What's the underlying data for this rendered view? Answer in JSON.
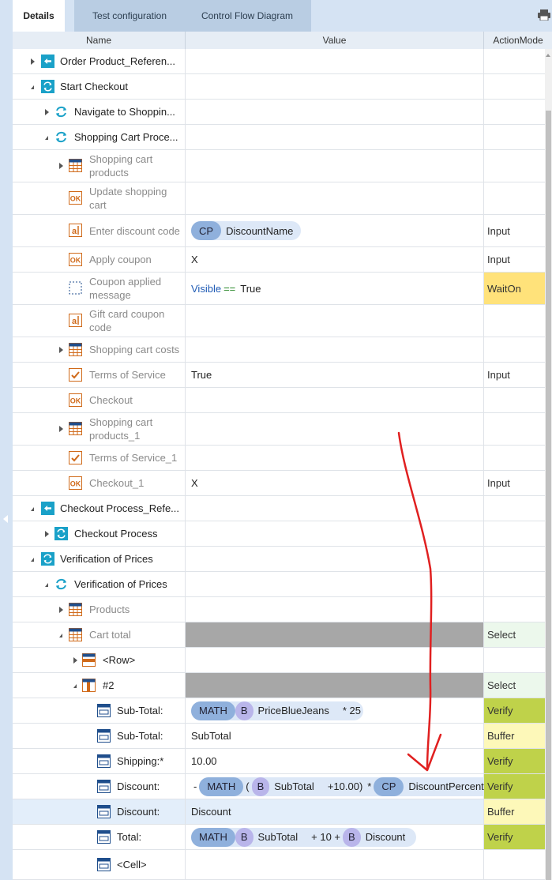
{
  "tabs": [
    {
      "label": "Details",
      "active": true
    },
    {
      "label": "Test configuration",
      "active": false
    },
    {
      "label": "Control Flow Diagram",
      "active": false
    }
  ],
  "columns": {
    "name": "Name",
    "value": "Value",
    "action": "ActionMode"
  },
  "rows": [
    {
      "label": "Order Product_Referen...",
      "icon": "reference-icon",
      "style": "dark",
      "expand": "collapsed"
    },
    {
      "label": "Start Checkout",
      "icon": "folder-module-icon",
      "style": "dark",
      "expand": "open"
    },
    {
      "label": "Navigate to Shoppin...",
      "icon": "refresh-module-icon",
      "style": "dark",
      "expand": "collapsed"
    },
    {
      "label": "Shopping Cart Proce...",
      "icon": "refresh-module-icon",
      "style": "dark",
      "expand": "open"
    },
    {
      "label": "Shopping cart products",
      "icon": "table-icon",
      "style": "dim",
      "expand": "collapsed"
    },
    {
      "label": "Update shopping cart",
      "icon": "ok-button-icon",
      "style": "dim"
    },
    {
      "label": "Enter discount code",
      "icon": "textbox-icon",
      "style": "dim",
      "action": "Input"
    },
    {
      "label": "Apply coupon",
      "icon": "ok-button-icon",
      "style": "dim",
      "value_text": "X",
      "action": "Input"
    },
    {
      "label": "Coupon applied message",
      "icon": "dashed-box-icon",
      "style": "dim",
      "action": "WaitOn"
    },
    {
      "label": "Gift card coupon code",
      "icon": "textbox-icon",
      "style": "dim"
    },
    {
      "label": "Shopping cart costs",
      "icon": "table-icon",
      "style": "dim",
      "expand": "collapsed"
    },
    {
      "label": "Terms of Service",
      "icon": "checkbox-icon",
      "style": "dim",
      "value_text": "True",
      "action": "Input"
    },
    {
      "label": "Checkout",
      "icon": "ok-button-icon",
      "style": "dim"
    },
    {
      "label": "Shopping cart products_1",
      "icon": "table-icon",
      "style": "dim",
      "expand": "collapsed"
    },
    {
      "label": "Terms of Service_1",
      "icon": "checkbox-icon",
      "style": "dim"
    },
    {
      "label": "Checkout_1",
      "icon": "ok-button-icon",
      "style": "dim",
      "value_text": "X",
      "action": "Input"
    },
    {
      "label": "Checkout Process_Refe...",
      "icon": "reference-icon",
      "style": "dark",
      "expand": "open"
    },
    {
      "label": "Checkout Process",
      "icon": "folder-module-icon",
      "style": "dark",
      "expand": "collapsed"
    },
    {
      "label": "Verification of Prices",
      "icon": "folder-module-icon",
      "style": "dark",
      "expand": "open"
    },
    {
      "label": "Verification of Prices",
      "icon": "refresh-module-icon",
      "style": "dark",
      "expand": "open"
    },
    {
      "label": "Products",
      "icon": "table-icon",
      "style": "dim",
      "expand": "collapsed"
    },
    {
      "label": "Cart total",
      "icon": "table-icon",
      "style": "dim",
      "expand": "open",
      "action": "Select"
    },
    {
      "label": "<Row>",
      "icon": "table-row-icon",
      "style": "dark",
      "expand": "collapsed"
    },
    {
      "label": "#2",
      "icon": "table-column-icon",
      "style": "dark",
      "expand": "open",
      "action": "Select"
    },
    {
      "label": "Sub-Total:",
      "icon": "cell-icon",
      "style": "dark",
      "action": "Verify"
    },
    {
      "label": "Sub-Total:",
      "icon": "cell-icon",
      "style": "dark",
      "value_text": "SubTotal",
      "action": "Buffer"
    },
    {
      "label": "Shipping:*",
      "icon": "cell-icon",
      "style": "dark",
      "value_text": "10.00",
      "action": "Verify"
    },
    {
      "label": "Discount:",
      "icon": "cell-icon",
      "style": "dark",
      "action": "Verify"
    },
    {
      "label": "Discount:",
      "icon": "cell-icon",
      "style": "dark",
      "value_text": "Discount",
      "action": "Buffer"
    },
    {
      "label": "Total:",
      "icon": "cell-icon",
      "style": "dark",
      "action": "Verify"
    },
    {
      "label": "<Cell>",
      "icon": "cell-icon",
      "style": "dark"
    }
  ],
  "expr": {
    "discount_code": {
      "tag": "CP",
      "name": "DiscountName"
    },
    "coupon_msg": {
      "prop": "Visible",
      "op": "==",
      "val": "True"
    },
    "subtotal_verify": {
      "math": "MATH",
      "tag": "B",
      "name": "PriceBlueJeans",
      "rest": "* 25"
    },
    "discount_verify": {
      "minus": "-",
      "math": "MATH",
      "open": "(",
      "tag1": "B",
      "name1": "SubTotal",
      "mid": "+10.00)",
      "times": "*",
      "tag2": "CP",
      "name2": "DiscountPercenta"
    },
    "total_verify": {
      "math": "MATH",
      "tag1": "B",
      "name1": "SubTotal",
      "mid": "+ 10 +",
      "tag2": "B",
      "name2": "Discount"
    }
  }
}
